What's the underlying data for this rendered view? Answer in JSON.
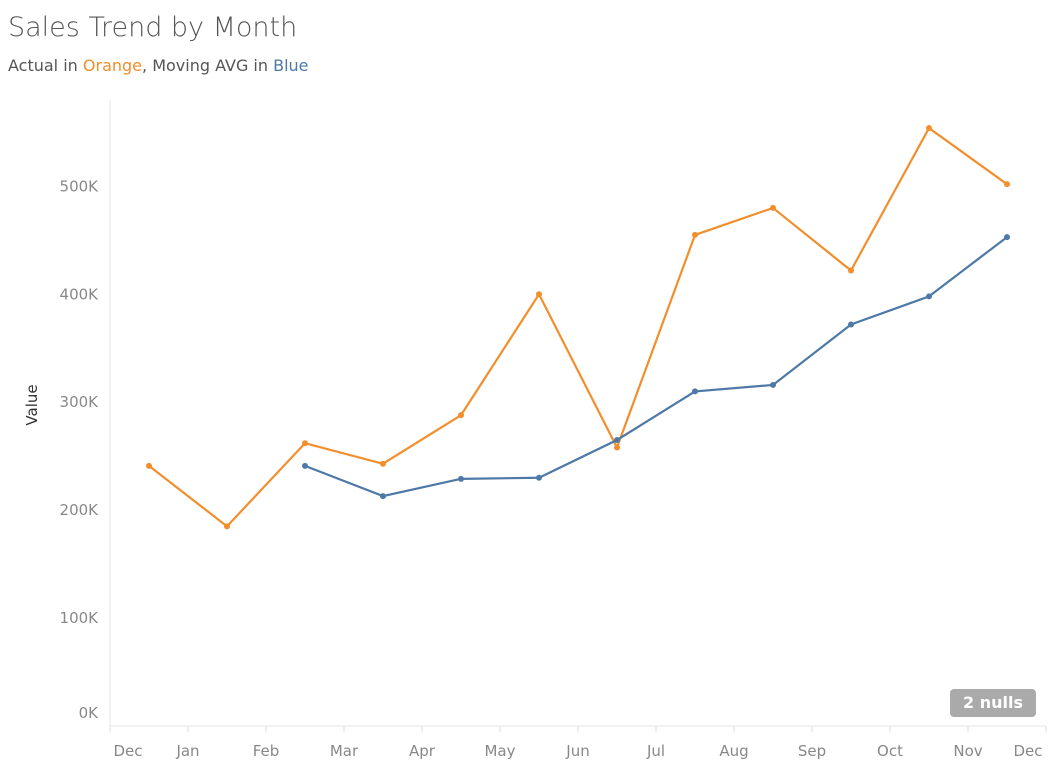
{
  "title": "Sales Trend by Month",
  "subtitle": {
    "prefix": "Actual in ",
    "orange": "Orange",
    "middle": ", Moving AVG in ",
    "blue": "Blue"
  },
  "nulls_badge": "2 nulls",
  "colors": {
    "actual": "#f28e2b",
    "moving_avg": "#4e79a7",
    "axis": "#e6e6e6"
  },
  "chart_data": {
    "type": "line",
    "title": "Sales Trend by Month",
    "ylabel": "Value",
    "xlabel": "",
    "x_tick_labels": [
      "Dec",
      "Jan",
      "Feb",
      "Mar",
      "Apr",
      "May",
      "Jun",
      "Jul",
      "Aug",
      "Sep",
      "Oct",
      "Nov",
      "Dec"
    ],
    "y_ticks": [
      0,
      100000,
      200000,
      300000,
      400000,
      500000
    ],
    "y_tick_labels": [
      "0K",
      "100K",
      "200K",
      "300K",
      "400K",
      "500K"
    ],
    "ylim": [
      0,
      580000
    ],
    "grid": false,
    "series": [
      {
        "key": "actual",
        "values": [
          241000,
          185000,
          262000,
          243000,
          288000,
          400000,
          258000,
          455000,
          480000,
          422000,
          554000,
          502000
        ]
      },
      {
        "key": "moving_avg",
        "values": [
          null,
          null,
          241000,
          213000,
          229000,
          230000,
          265000,
          310000,
          316000,
          372000,
          398000,
          453000
        ]
      }
    ]
  }
}
